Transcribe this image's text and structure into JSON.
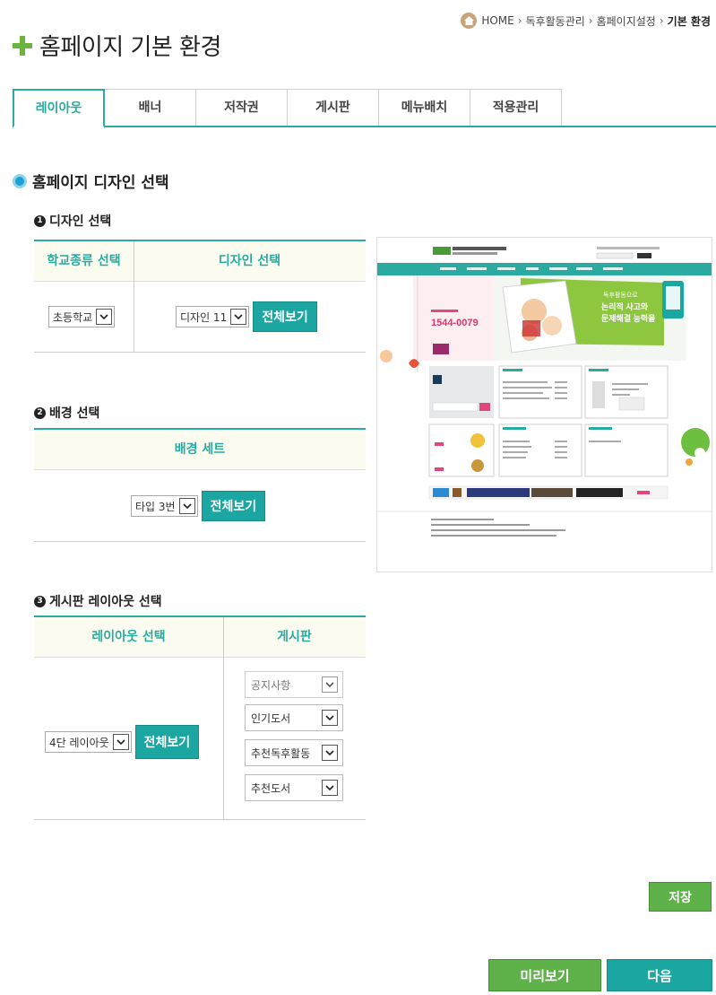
{
  "breadcrumb": {
    "items": [
      "HOME",
      "독후활동관리",
      "홈페이지설정",
      "기본 환경"
    ]
  },
  "page_title": "홈페이지 기본 환경",
  "tabs": [
    {
      "label": "레이아웃",
      "active": true
    },
    {
      "label": "배너",
      "active": false
    },
    {
      "label": "저작권",
      "active": false
    },
    {
      "label": "게시판",
      "active": false
    },
    {
      "label": "메뉴배치",
      "active": false
    },
    {
      "label": "적용관리",
      "active": false
    }
  ],
  "section_title": "홈페이지 디자인 선택",
  "design": {
    "heading_num": "1",
    "heading": "디자인 선택",
    "col_school": "학교종류 선택",
    "col_design": "디자인 선택",
    "school_value": "초등학교",
    "design_value": "디자인 11",
    "view_all": "전체보기"
  },
  "background": {
    "heading_num": "2",
    "heading": "배경 선택",
    "col_set": "배경 세트",
    "set_value": "타입 3번",
    "view_all": "전체보기"
  },
  "board_layout": {
    "heading_num": "3",
    "heading": "게시판 레이아웃 선택",
    "col_layout": "레이아웃 선택",
    "col_board": "게시판",
    "layout_value": "4단 레이아웃",
    "view_all": "전체보기",
    "boards": [
      "공지사항",
      "인기도서",
      "추천독후활동",
      "추천도서"
    ]
  },
  "preview": {
    "phone_label": "1544-0079",
    "banner_text_1": "독후활동으로",
    "banner_text_2": "논리적 사고와",
    "banner_text_3": "문제해결 능력을"
  },
  "buttons": {
    "save": "저장",
    "preview": "미리보기",
    "next": "다음"
  },
  "colors": {
    "accent": "#2aaaa0",
    "green": "#5fb24a",
    "teal_button": "#1ba6a2"
  }
}
